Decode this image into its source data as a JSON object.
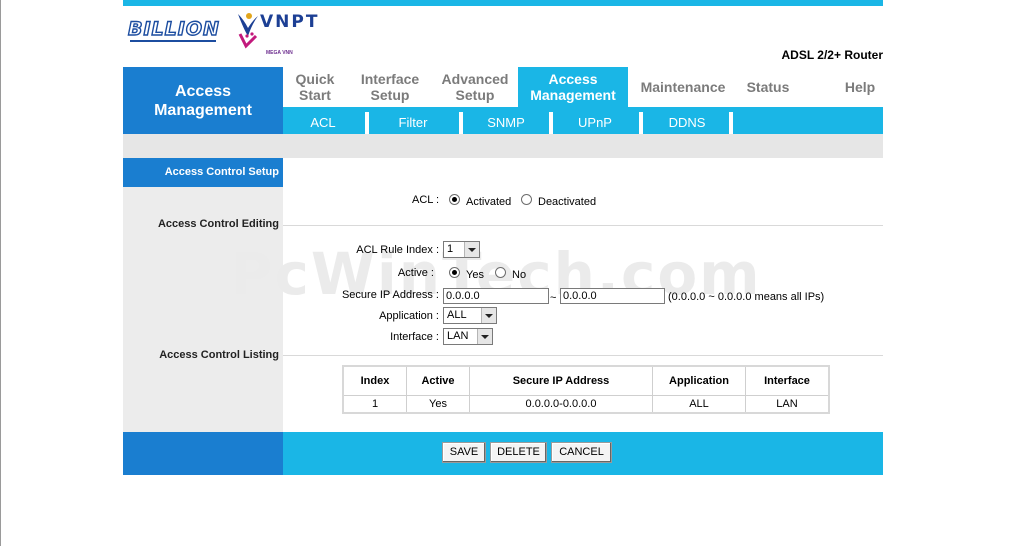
{
  "header": {
    "model": "ADSL 2/2+ Router",
    "brand_left": "BILLION",
    "brand_right": "VNPT",
    "brand_right_tag": "MEGA VNN"
  },
  "side_title": "Access Management",
  "nav": {
    "tabs": [
      {
        "label": "Quick Start"
      },
      {
        "label": "Interface Setup"
      },
      {
        "label": "Advanced Setup"
      },
      {
        "label": "Access Management"
      },
      {
        "label": "Maintenance"
      },
      {
        "label": "Status"
      },
      {
        "label": "Help"
      }
    ],
    "subtabs": [
      {
        "label": "ACL"
      },
      {
        "label": "Filter"
      },
      {
        "label": "SNMP"
      },
      {
        "label": "UPnP"
      },
      {
        "label": "DDNS"
      }
    ]
  },
  "sections": {
    "setup": "Access Control Setup",
    "editing": "Access Control Editing",
    "listing": "Access Control Listing"
  },
  "acl": {
    "label": "ACL :",
    "activated": "Activated",
    "deactivated": "Deactivated"
  },
  "form": {
    "rule_index_label": "ACL Rule Index :",
    "rule_index_value": "1",
    "active_label": "Active :",
    "yes": "Yes",
    "no": "No",
    "secure_ip_label": "Secure IP Address :",
    "ip_start": "0.0.0.0",
    "tilde": "~",
    "ip_end": "0.0.0.0",
    "ip_hint": "(0.0.0.0 ~ 0.0.0.0 means all IPs)",
    "application_label": "Application :",
    "application_value": "ALL",
    "interface_label": "Interface :",
    "interface_value": "LAN"
  },
  "table": {
    "headers": [
      "Index",
      "Active",
      "Secure IP Address",
      "Application",
      "Interface"
    ],
    "rows": [
      [
        "1",
        "Yes",
        "0.0.0.0-0.0.0.0",
        "ALL",
        "LAN"
      ]
    ]
  },
  "buttons": {
    "save": "SAVE",
    "delete": "DELETE",
    "cancel": "CANCEL"
  },
  "watermark": "PcWinTech.com",
  "colors": {
    "accent": "#1ab6e6",
    "dark_blue": "#1a7ed0"
  }
}
